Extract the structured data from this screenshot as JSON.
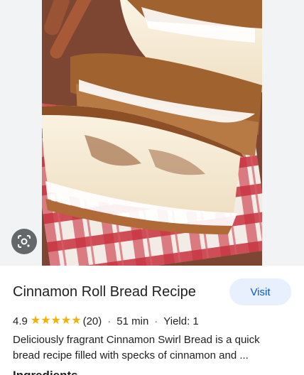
{
  "recipe": {
    "title": "Cinnamon Roll Bread Recipe",
    "visit_label": "Visit",
    "rating": "4.9",
    "stars": [
      "★",
      "★",
      "★",
      "★",
      "★"
    ],
    "review_count": "(20)",
    "time": "51 min",
    "yield": "Yield: 1",
    "description_line1": "Deliciously fragrant Cinnamon Swirl Bread is a quick",
    "description_line2": "bread recipe filled with specks of cinnamon and ...",
    "next_heading": "Ingredients"
  },
  "meta": {
    "separator": "·"
  },
  "icons": {
    "lens": "google-lens-icon",
    "star": "star-icon"
  },
  "colors": {
    "accent": "#0b57d0",
    "visit_bg": "#e8f0fe",
    "star": "#f6b100",
    "text": "#1f1f1f"
  }
}
